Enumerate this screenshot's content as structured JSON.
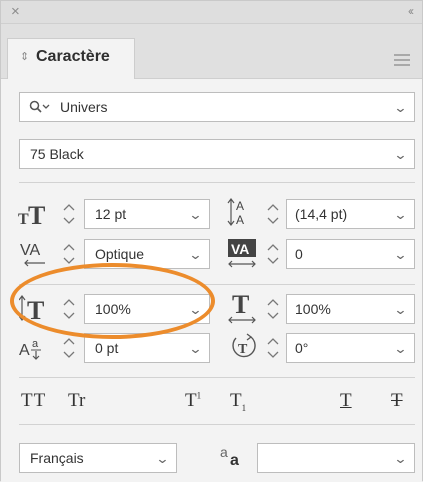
{
  "window": {
    "close_glyph": "×",
    "collapse_glyph": "‹‹"
  },
  "tab": {
    "title": "Caractère"
  },
  "font": {
    "family": "Univers",
    "style": "75 Black"
  },
  "rows": {
    "size": "12 pt",
    "leading": "(14,4 pt)",
    "kerning": "Optique",
    "tracking": "0",
    "vertical_scale": "100%",
    "horizontal_scale": "100%",
    "baseline_shift": "0 pt",
    "rotation": "0°"
  },
  "type_buttons": {
    "all_caps": "TT",
    "small_caps": "Tr",
    "superscript": "T",
    "subscript": "T",
    "underline": "T",
    "strikethrough": "T"
  },
  "language": {
    "value": "Français",
    "aa_label": "a"
  },
  "icons": [
    "close-icon",
    "collapse-icon",
    "panel-menu-icon",
    "search-icon",
    "chevron-down-icon",
    "spinner-icon"
  ],
  "colors": {
    "highlight": "#ec8c2c",
    "panel": "#f3f3f3"
  }
}
